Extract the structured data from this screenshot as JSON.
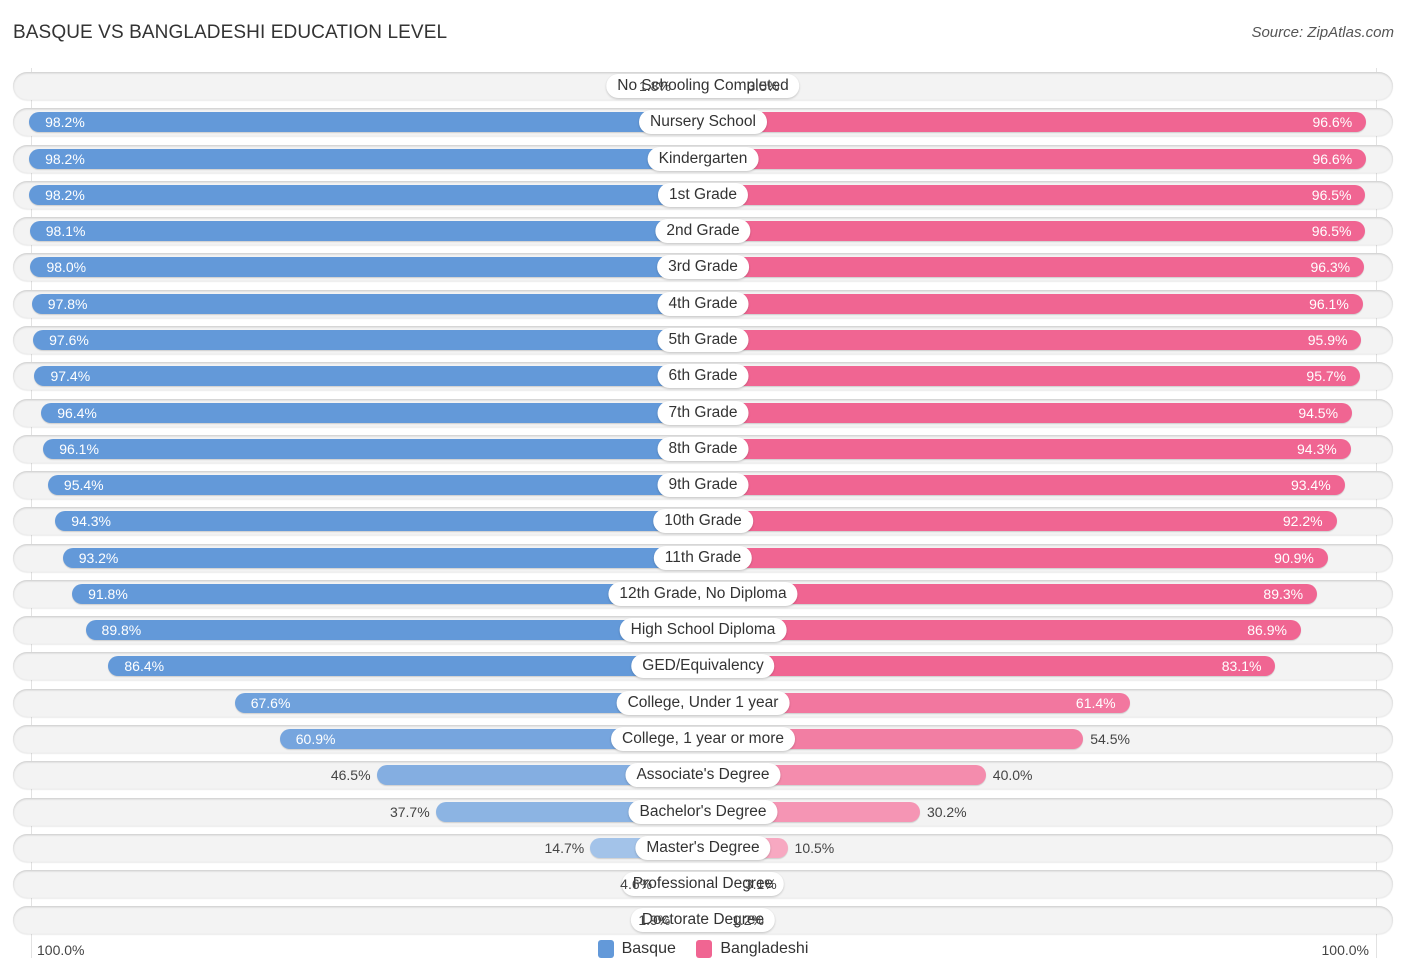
{
  "header": {
    "title": "BASQUE VS BANGLADESHI EDUCATION LEVEL",
    "source": "Source: ZipAtlas.com"
  },
  "colors": {
    "basque": "#6399d9",
    "bangladeshi": "#f06592"
  },
  "chart_data": {
    "type": "bar",
    "orientation": "horizontal-diverging",
    "title": "BASQUE VS BANGLADESHI EDUCATION LEVEL",
    "xlabel": "",
    "ylabel": "",
    "xlim": [
      0,
      100
    ],
    "axis_left_label": "100.0%",
    "axis_right_label": "100.0%",
    "legend_position": "bottom-center",
    "categories": [
      "No Schooling Completed",
      "Nursery School",
      "Kindergarten",
      "1st Grade",
      "2nd Grade",
      "3rd Grade",
      "4th Grade",
      "5th Grade",
      "6th Grade",
      "7th Grade",
      "8th Grade",
      "9th Grade",
      "10th Grade",
      "11th Grade",
      "12th Grade, No Diploma",
      "High School Diploma",
      "GED/Equivalency",
      "College, Under 1 year",
      "College, 1 year or more",
      "Associate's Degree",
      "Bachelor's Degree",
      "Master's Degree",
      "Professional Degree",
      "Doctorate Degree"
    ],
    "series": [
      {
        "name": "Basque",
        "values": [
          1.8,
          98.2,
          98.2,
          98.2,
          98.1,
          98.0,
          97.8,
          97.6,
          97.4,
          96.4,
          96.1,
          95.4,
          94.3,
          93.2,
          91.8,
          89.8,
          86.4,
          67.6,
          60.9,
          46.5,
          37.7,
          14.7,
          4.6,
          1.9
        ],
        "labels": [
          "1.8%",
          "98.2%",
          "98.2%",
          "98.2%",
          "98.1%",
          "98.0%",
          "97.8%",
          "97.6%",
          "97.4%",
          "96.4%",
          "96.1%",
          "95.4%",
          "94.3%",
          "93.2%",
          "91.8%",
          "89.8%",
          "86.4%",
          "67.6%",
          "60.9%",
          "46.5%",
          "37.7%",
          "14.7%",
          "4.6%",
          "1.9%"
        ]
      },
      {
        "name": "Bangladeshi",
        "values": [
          3.5,
          96.6,
          96.6,
          96.5,
          96.5,
          96.3,
          96.1,
          95.9,
          95.7,
          94.5,
          94.3,
          93.4,
          92.2,
          90.9,
          89.3,
          86.9,
          83.1,
          61.4,
          54.5,
          40.0,
          30.2,
          10.5,
          3.1,
          1.2
        ],
        "labels": [
          "3.5%",
          "96.6%",
          "96.6%",
          "96.5%",
          "96.5%",
          "96.3%",
          "96.1%",
          "95.9%",
          "95.7%",
          "94.5%",
          "94.3%",
          "93.4%",
          "92.2%",
          "90.9%",
          "89.3%",
          "86.9%",
          "83.1%",
          "61.4%",
          "54.5%",
          "40.0%",
          "30.2%",
          "10.5%",
          "3.1%",
          "1.2%"
        ]
      }
    ]
  }
}
